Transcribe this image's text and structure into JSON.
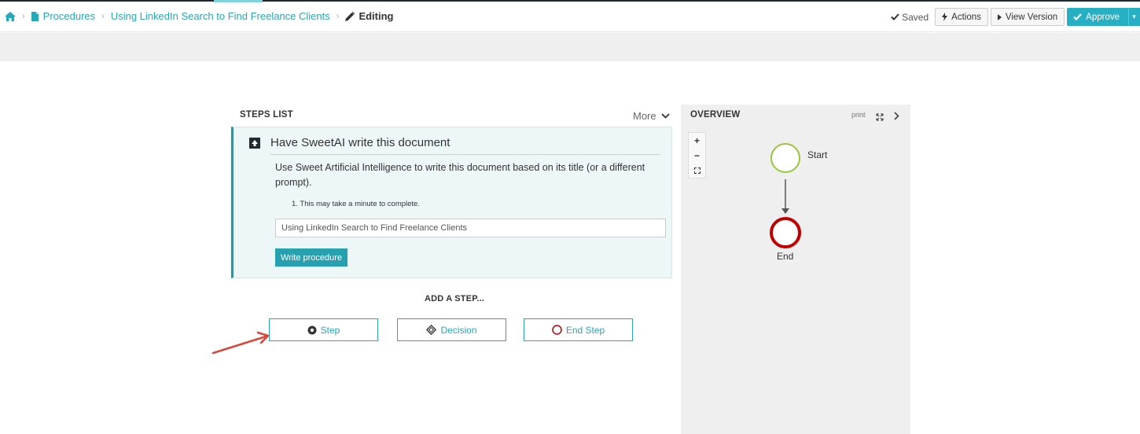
{
  "breadcrumb": {
    "home_icon": "home-icon",
    "procedures": "Procedures",
    "document": "Using LinkedIn Search to Find Freelance Clients",
    "current": "Editing"
  },
  "header": {
    "saved": "Saved",
    "actions": "Actions",
    "view_version": "View Version",
    "approve": "Approve"
  },
  "steps": {
    "title": "STEPS LIST",
    "more": "More",
    "ai": {
      "title": "Have SweetAI write this document",
      "description": "Use Sweet Artificial Intelligence to write this document based on its title (or a different prompt).",
      "note": "1. This may take a minute to complete.",
      "input_value": "Using LinkedIn Search to Find Freelance Clients",
      "button": "Write procedure"
    },
    "add_step": "ADD A STEP...",
    "buttons": {
      "step": "Step",
      "decision": "Decision",
      "end_step": "End Step"
    }
  },
  "overview": {
    "title": "OVERVIEW",
    "print": "print",
    "zoom_in": "+",
    "zoom_out": "−",
    "start": "Start",
    "end": "End"
  },
  "colors": {
    "accent": "#27a8b8",
    "approve": "#27b0c4",
    "start_node": "#9bc53d",
    "end_node": "#c00000",
    "annotation_arrow": "#d9473b"
  }
}
